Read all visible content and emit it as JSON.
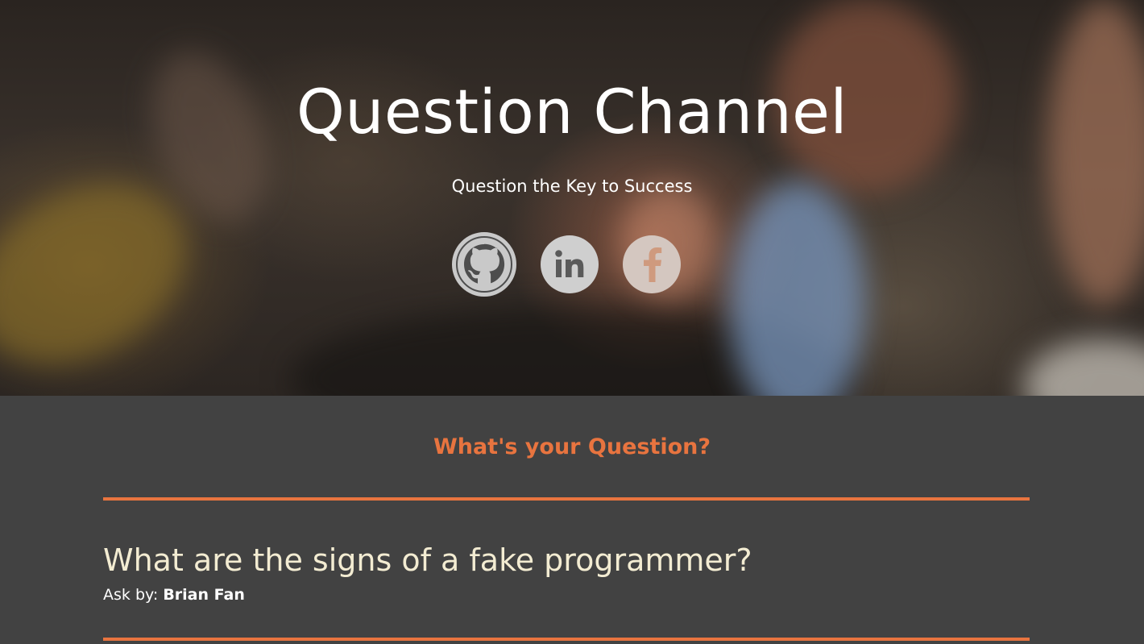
{
  "hero": {
    "title": "Question Channel",
    "subtitle": "Question the Key to Success",
    "social": [
      {
        "name": "GitHub",
        "icon": "github-icon"
      },
      {
        "name": "LinkedIn",
        "icon": "linkedin-icon",
        "glyph": "in"
      },
      {
        "name": "Facebook",
        "icon": "facebook-icon",
        "glyph": "f"
      }
    ]
  },
  "main": {
    "heading": "What's your Question?",
    "questions": [
      {
        "title": "What are the signs of a fake programmer?",
        "ask_label": "Ask by:",
        "author": "Brian Fan"
      }
    ]
  },
  "colors": {
    "accent": "#e8743f",
    "background": "#424242",
    "question_text": "#f3ecd2",
    "icon_gray": "#c9c9c9"
  }
}
